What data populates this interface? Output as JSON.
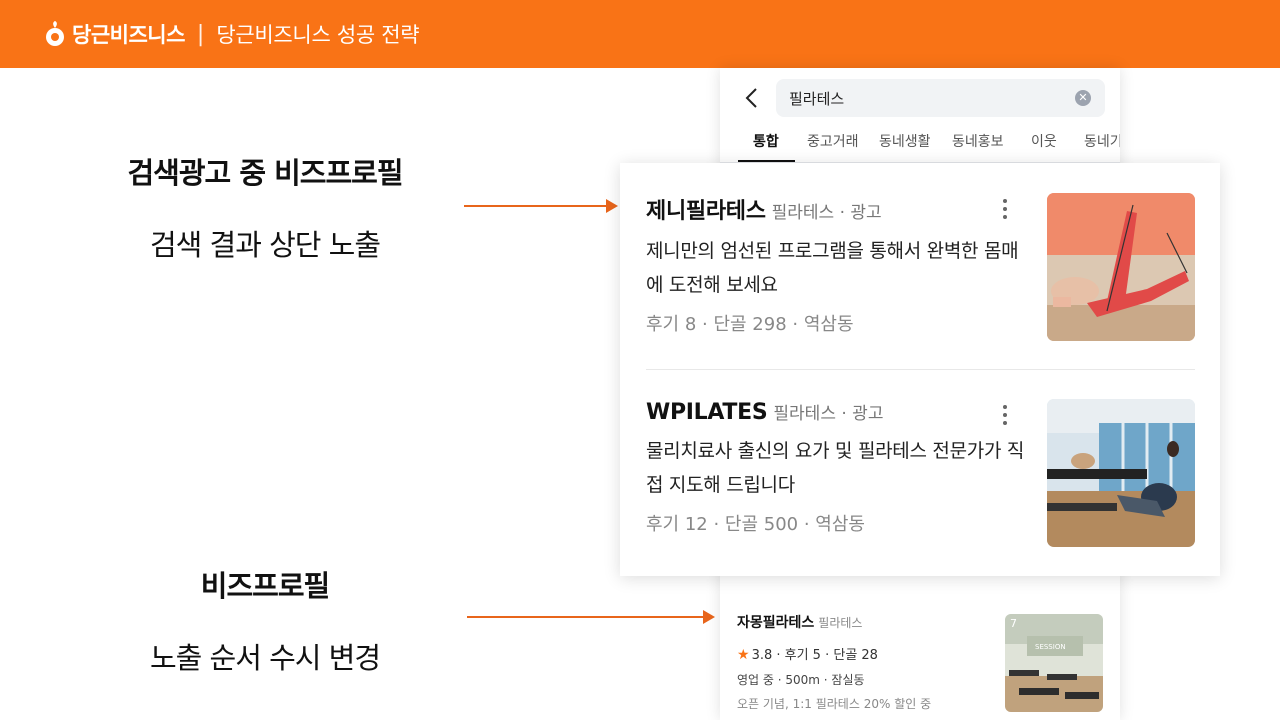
{
  "header": {
    "brand": "당근비즈니스",
    "separator": "|",
    "title": "당근비즈니스 성공 전략"
  },
  "callouts": [
    {
      "heading": "검색광고 중 비즈프로필",
      "sub": "검색 결과 상단 노출"
    },
    {
      "heading": "비즈프로필",
      "sub": "노출 순서 수시 변경"
    }
  ],
  "phone": {
    "search": {
      "value": "필라테스"
    },
    "tabs": [
      "통합",
      "중고거래",
      "동네생활",
      "동네홍보",
      "이웃",
      "동네기"
    ],
    "active_tab": "통합"
  },
  "ads": [
    {
      "name": "제니필라테스",
      "meta": "필라테스 · 광고",
      "description": "제니만의 엄선된 프로그램을 통해서 완벽한 몸매에 도전해 보세요",
      "stats": "후기 8 · 단골 298 · 역삼동"
    },
    {
      "name": "WPILATES",
      "meta": "필라테스 · 광고",
      "description": "물리치료사 출신의 요가 및 필라테스 전문가가 직접 지도해 드립니다",
      "stats": "후기 12 · 단골 500 · 역삼동"
    }
  ],
  "listing": {
    "name": "자몽필라테스",
    "category": "필라테스",
    "rating": "3.8 · 후기 5 · 단골 28",
    "status": "영업 중 · 500m · 잠실동",
    "promo": "오픈 기념, 1:1 필라테스 20% 할인 중",
    "photo_count": "7",
    "sign_text": "SESSION"
  },
  "colors": {
    "brand_orange": "#f97316",
    "arrow": "#e8651b"
  }
}
